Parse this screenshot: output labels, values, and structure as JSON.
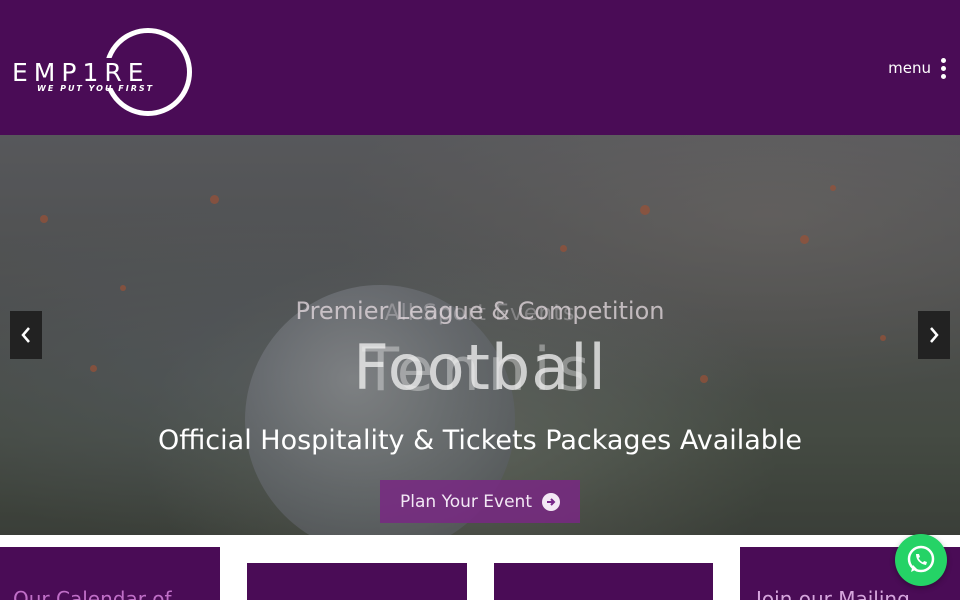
{
  "header": {
    "logo": {
      "wordmark": "EMP1RE",
      "tagline": "WE PUT YOU FIRST"
    },
    "menu_label": "menu"
  },
  "hero": {
    "subtitle": "Premier League & Competition",
    "subtitle_ghost": "All Sport Events",
    "title": "Football",
    "title_ghost": "Tennis",
    "tagline": "Official Hospitality & Tickets Packages Available",
    "cta_label": "Plan Your Event",
    "prev_icon": "chevron-left-icon",
    "next_icon": "chevron-right-icon"
  },
  "cards": [
    {
      "title": "Our Calendar of"
    },
    {
      "title": ""
    },
    {
      "title": ""
    },
    {
      "title": "Join our Mailing"
    }
  ],
  "whatsapp_icon": "whatsapp-icon",
  "colors": {
    "brand_purple": "#4a0c56",
    "cta_purple": "#78288a",
    "whatsapp_green": "#25d366"
  }
}
